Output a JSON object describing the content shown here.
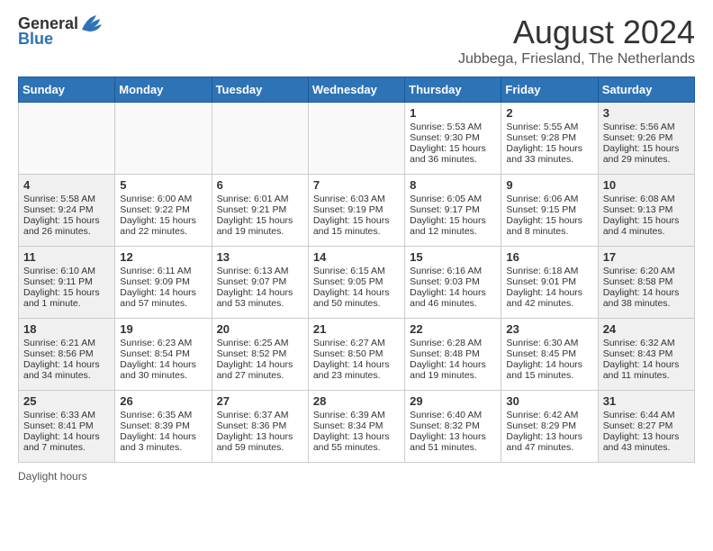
{
  "header": {
    "logo_general": "General",
    "logo_blue": "Blue",
    "main_title": "August 2024",
    "subtitle": "Jubbega, Friesland, The Netherlands"
  },
  "calendar": {
    "days_of_week": [
      "Sunday",
      "Monday",
      "Tuesday",
      "Wednesday",
      "Thursday",
      "Friday",
      "Saturday"
    ],
    "footer": "Daylight hours"
  },
  "weeks": [
    [
      {
        "date": "",
        "sunrise": "",
        "sunset": "",
        "daylight": "",
        "empty": true
      },
      {
        "date": "",
        "sunrise": "",
        "sunset": "",
        "daylight": "",
        "empty": true
      },
      {
        "date": "",
        "sunrise": "",
        "sunset": "",
        "daylight": "",
        "empty": true
      },
      {
        "date": "",
        "sunrise": "",
        "sunset": "",
        "daylight": "",
        "empty": true
      },
      {
        "date": "1",
        "sunrise": "Sunrise: 5:53 AM",
        "sunset": "Sunset: 9:30 PM",
        "daylight": "Daylight: 15 hours and 36 minutes.",
        "empty": false,
        "weekend": false
      },
      {
        "date": "2",
        "sunrise": "Sunrise: 5:55 AM",
        "sunset": "Sunset: 9:28 PM",
        "daylight": "Daylight: 15 hours and 33 minutes.",
        "empty": false,
        "weekend": false
      },
      {
        "date": "3",
        "sunrise": "Sunrise: 5:56 AM",
        "sunset": "Sunset: 9:26 PM",
        "daylight": "Daylight: 15 hours and 29 minutes.",
        "empty": false,
        "weekend": true
      }
    ],
    [
      {
        "date": "4",
        "sunrise": "Sunrise: 5:58 AM",
        "sunset": "Sunset: 9:24 PM",
        "daylight": "Daylight: 15 hours and 26 minutes.",
        "empty": false,
        "weekend": true
      },
      {
        "date": "5",
        "sunrise": "Sunrise: 6:00 AM",
        "sunset": "Sunset: 9:22 PM",
        "daylight": "Daylight: 15 hours and 22 minutes.",
        "empty": false,
        "weekend": false
      },
      {
        "date": "6",
        "sunrise": "Sunrise: 6:01 AM",
        "sunset": "Sunset: 9:21 PM",
        "daylight": "Daylight: 15 hours and 19 minutes.",
        "empty": false,
        "weekend": false
      },
      {
        "date": "7",
        "sunrise": "Sunrise: 6:03 AM",
        "sunset": "Sunset: 9:19 PM",
        "daylight": "Daylight: 15 hours and 15 minutes.",
        "empty": false,
        "weekend": false
      },
      {
        "date": "8",
        "sunrise": "Sunrise: 6:05 AM",
        "sunset": "Sunset: 9:17 PM",
        "daylight": "Daylight: 15 hours and 12 minutes.",
        "empty": false,
        "weekend": false
      },
      {
        "date": "9",
        "sunrise": "Sunrise: 6:06 AM",
        "sunset": "Sunset: 9:15 PM",
        "daylight": "Daylight: 15 hours and 8 minutes.",
        "empty": false,
        "weekend": false
      },
      {
        "date": "10",
        "sunrise": "Sunrise: 6:08 AM",
        "sunset": "Sunset: 9:13 PM",
        "daylight": "Daylight: 15 hours and 4 minutes.",
        "empty": false,
        "weekend": true
      }
    ],
    [
      {
        "date": "11",
        "sunrise": "Sunrise: 6:10 AM",
        "sunset": "Sunset: 9:11 PM",
        "daylight": "Daylight: 15 hours and 1 minute.",
        "empty": false,
        "weekend": true
      },
      {
        "date": "12",
        "sunrise": "Sunrise: 6:11 AM",
        "sunset": "Sunset: 9:09 PM",
        "daylight": "Daylight: 14 hours and 57 minutes.",
        "empty": false,
        "weekend": false
      },
      {
        "date": "13",
        "sunrise": "Sunrise: 6:13 AM",
        "sunset": "Sunset: 9:07 PM",
        "daylight": "Daylight: 14 hours and 53 minutes.",
        "empty": false,
        "weekend": false
      },
      {
        "date": "14",
        "sunrise": "Sunrise: 6:15 AM",
        "sunset": "Sunset: 9:05 PM",
        "daylight": "Daylight: 14 hours and 50 minutes.",
        "empty": false,
        "weekend": false
      },
      {
        "date": "15",
        "sunrise": "Sunrise: 6:16 AM",
        "sunset": "Sunset: 9:03 PM",
        "daylight": "Daylight: 14 hours and 46 minutes.",
        "empty": false,
        "weekend": false
      },
      {
        "date": "16",
        "sunrise": "Sunrise: 6:18 AM",
        "sunset": "Sunset: 9:01 PM",
        "daylight": "Daylight: 14 hours and 42 minutes.",
        "empty": false,
        "weekend": false
      },
      {
        "date": "17",
        "sunrise": "Sunrise: 6:20 AM",
        "sunset": "Sunset: 8:58 PM",
        "daylight": "Daylight: 14 hours and 38 minutes.",
        "empty": false,
        "weekend": true
      }
    ],
    [
      {
        "date": "18",
        "sunrise": "Sunrise: 6:21 AM",
        "sunset": "Sunset: 8:56 PM",
        "daylight": "Daylight: 14 hours and 34 minutes.",
        "empty": false,
        "weekend": true
      },
      {
        "date": "19",
        "sunrise": "Sunrise: 6:23 AM",
        "sunset": "Sunset: 8:54 PM",
        "daylight": "Daylight: 14 hours and 30 minutes.",
        "empty": false,
        "weekend": false
      },
      {
        "date": "20",
        "sunrise": "Sunrise: 6:25 AM",
        "sunset": "Sunset: 8:52 PM",
        "daylight": "Daylight: 14 hours and 27 minutes.",
        "empty": false,
        "weekend": false
      },
      {
        "date": "21",
        "sunrise": "Sunrise: 6:27 AM",
        "sunset": "Sunset: 8:50 PM",
        "daylight": "Daylight: 14 hours and 23 minutes.",
        "empty": false,
        "weekend": false
      },
      {
        "date": "22",
        "sunrise": "Sunrise: 6:28 AM",
        "sunset": "Sunset: 8:48 PM",
        "daylight": "Daylight: 14 hours and 19 minutes.",
        "empty": false,
        "weekend": false
      },
      {
        "date": "23",
        "sunrise": "Sunrise: 6:30 AM",
        "sunset": "Sunset: 8:45 PM",
        "daylight": "Daylight: 14 hours and 15 minutes.",
        "empty": false,
        "weekend": false
      },
      {
        "date": "24",
        "sunrise": "Sunrise: 6:32 AM",
        "sunset": "Sunset: 8:43 PM",
        "daylight": "Daylight: 14 hours and 11 minutes.",
        "empty": false,
        "weekend": true
      }
    ],
    [
      {
        "date": "25",
        "sunrise": "Sunrise: 6:33 AM",
        "sunset": "Sunset: 8:41 PM",
        "daylight": "Daylight: 14 hours and 7 minutes.",
        "empty": false,
        "weekend": true
      },
      {
        "date": "26",
        "sunrise": "Sunrise: 6:35 AM",
        "sunset": "Sunset: 8:39 PM",
        "daylight": "Daylight: 14 hours and 3 minutes.",
        "empty": false,
        "weekend": false
      },
      {
        "date": "27",
        "sunrise": "Sunrise: 6:37 AM",
        "sunset": "Sunset: 8:36 PM",
        "daylight": "Daylight: 13 hours and 59 minutes.",
        "empty": false,
        "weekend": false
      },
      {
        "date": "28",
        "sunrise": "Sunrise: 6:39 AM",
        "sunset": "Sunset: 8:34 PM",
        "daylight": "Daylight: 13 hours and 55 minutes.",
        "empty": false,
        "weekend": false
      },
      {
        "date": "29",
        "sunrise": "Sunrise: 6:40 AM",
        "sunset": "Sunset: 8:32 PM",
        "daylight": "Daylight: 13 hours and 51 minutes.",
        "empty": false,
        "weekend": false
      },
      {
        "date": "30",
        "sunrise": "Sunrise: 6:42 AM",
        "sunset": "Sunset: 8:29 PM",
        "daylight": "Daylight: 13 hours and 47 minutes.",
        "empty": false,
        "weekend": false
      },
      {
        "date": "31",
        "sunrise": "Sunrise: 6:44 AM",
        "sunset": "Sunset: 8:27 PM",
        "daylight": "Daylight: 13 hours and 43 minutes.",
        "empty": false,
        "weekend": true
      }
    ]
  ]
}
